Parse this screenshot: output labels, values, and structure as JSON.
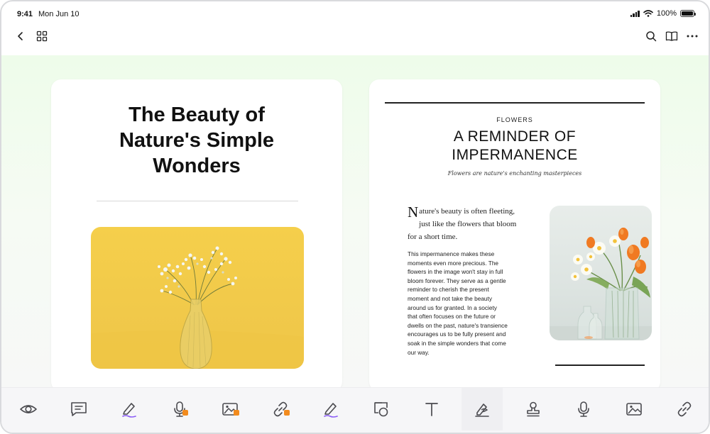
{
  "status_bar": {
    "time": "9:41",
    "date": "Mon Jun 10",
    "battery": "100%",
    "battery_level": 1.0
  },
  "nav": {
    "back_icon": "chevron-left-icon",
    "grid_icon": "grid-icon",
    "search_icon": "search-icon",
    "book_icon": "book-icon",
    "more_icon": "more-icon"
  },
  "left_page": {
    "title_lines": [
      "The Beauty of",
      "Nature's Simple",
      "Wonders"
    ]
  },
  "right_page": {
    "kicker": "FLOWERS",
    "title_lines": [
      "A REMINDER OF",
      "IMPERMANENCE"
    ],
    "tagline": "Flowers are nature's enchanting masterpieces",
    "dropcap": "N",
    "lead": "ature's beauty is often fleeting, just like the flowers that bloom for a short time.",
    "body_lines": [
      "This impermanence makes these",
      "moments even more precious. The",
      "flowers in the image won't stay in full",
      "bloom forever. They serve as a gentle",
      "reminder to cherish the present",
      "moment and not take the beauty",
      "around us for granted. In a society",
      "that often focuses on the future or",
      "dwells on the past, nature's transience",
      "encourages us to be fully present and",
      "soak in the simple wonders that come",
      "our way."
    ]
  },
  "toolbar": {
    "tools": [
      {
        "icon": "eye-icon",
        "locked": false,
        "active": false
      },
      {
        "icon": "comment-icon",
        "locked": false,
        "active": false
      },
      {
        "icon": "highlighter-icon",
        "locked": false,
        "active": false
      },
      {
        "icon": "microphone-icon",
        "locked": true,
        "active": false
      },
      {
        "icon": "image-icon",
        "locked": true,
        "active": false
      },
      {
        "icon": "link-icon",
        "locked": true,
        "active": false
      },
      {
        "icon": "highlighter-icon",
        "locked": false,
        "active": false
      },
      {
        "icon": "shapes-icon",
        "locked": false,
        "active": false
      },
      {
        "icon": "text-icon",
        "locked": false,
        "active": false
      },
      {
        "icon": "signature-icon",
        "locked": false,
        "active": true
      },
      {
        "icon": "stamp-icon",
        "locked": false,
        "active": false
      },
      {
        "icon": "microphone-icon",
        "locked": false,
        "active": false
      },
      {
        "icon": "image-icon",
        "locked": false,
        "active": false
      },
      {
        "icon": "link-icon",
        "locked": false,
        "active": false
      }
    ]
  },
  "colors": {
    "accent_purple": "#8b5cf6",
    "lock_orange": "#f28b1e",
    "icon_gray": "#4a4a4f",
    "canvas_green": "#eefcea"
  }
}
